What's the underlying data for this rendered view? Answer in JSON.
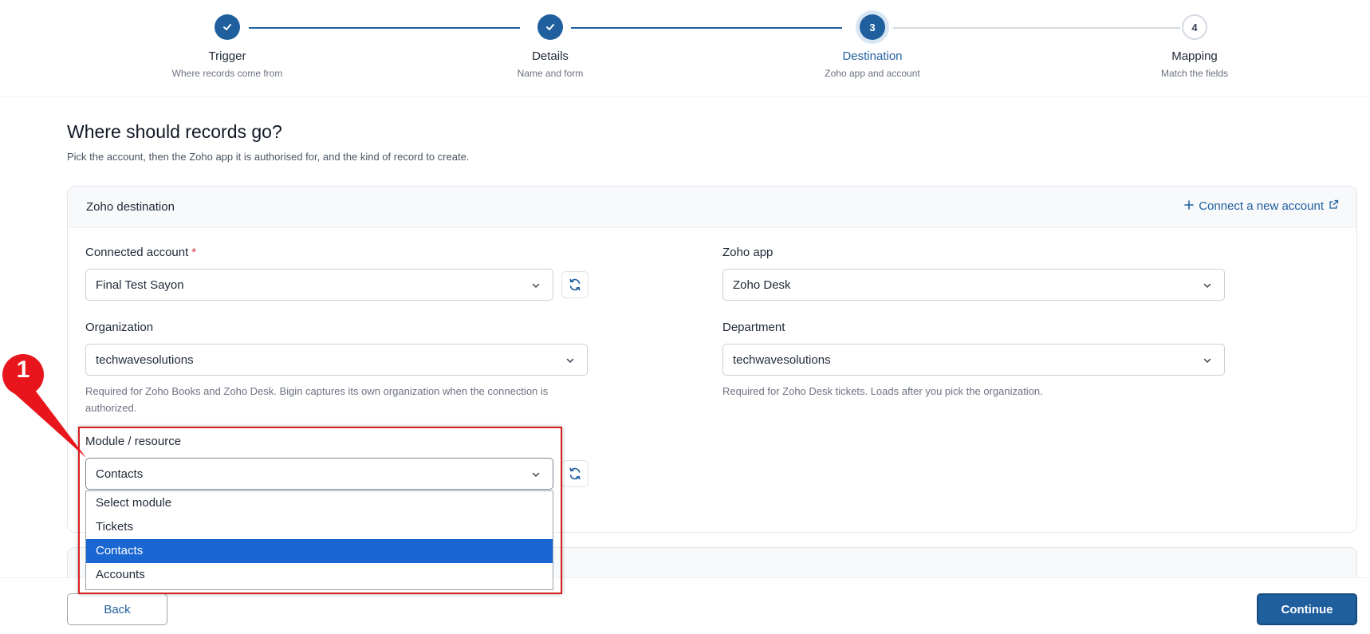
{
  "stepper": {
    "steps": [
      {
        "number": "1",
        "title": "Trigger",
        "subtitle": "Where records come from",
        "state": "done"
      },
      {
        "number": "2",
        "title": "Details",
        "subtitle": "Name and form",
        "state": "done"
      },
      {
        "number": "3",
        "title": "Destination",
        "subtitle": "Zoho app and account",
        "state": "current"
      },
      {
        "number": "4",
        "title": "Mapping",
        "subtitle": "Match the fields",
        "state": "todo"
      }
    ]
  },
  "header": {
    "title": "Where should records go?",
    "subtitle": "Pick the account, then the Zoho app it is authorised for, and the kind of record to create."
  },
  "card": {
    "title": "Zoho destination",
    "connect_link": "Connect a new account",
    "connected_account": {
      "label": "Connected account",
      "required_mark": "*",
      "value": "Final Test Sayon"
    },
    "zoho_app": {
      "label": "Zoho app",
      "value": "Zoho Desk"
    },
    "organization": {
      "label": "Organization",
      "value": "techwavesolutions",
      "help": "Required for Zoho Books and Zoho Desk. Bigin captures its own organization when the connection is authorized."
    },
    "department": {
      "label": "Department",
      "value": "techwavesolutions",
      "help": "Required for Zoho Desk tickets. Loads after you pick the organization."
    },
    "module": {
      "label": "Module / resource",
      "value": "Contacts",
      "options": [
        "Select module",
        "Tickets",
        "Contacts",
        "Accounts"
      ],
      "selected_index": 2
    }
  },
  "annotation": {
    "number": "1",
    "color": "#d92020"
  },
  "footer": {
    "back_label": "Back",
    "continue_label": "Continue"
  },
  "colors": {
    "primary": "#1f5f9e",
    "selected_option": "#1a66d2",
    "required": "#d03b3b"
  }
}
